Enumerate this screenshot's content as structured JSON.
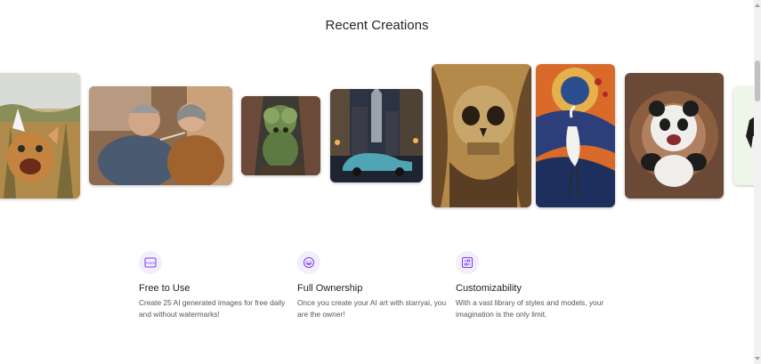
{
  "section": {
    "title": "Recent Creations"
  },
  "gallery": {
    "images": [
      "cat-in-cornfield-image",
      "elderly-couple-painting-image",
      "broccoli-creature-image",
      "vintage-car-city-image",
      "golden-skull-image",
      "crane-bird-art-image",
      "panda-portrait-image",
      "partial-next-image"
    ]
  },
  "features": [
    {
      "icon": "free-badge-icon",
      "title": "Free to Use",
      "text": "Create 25 AI generated images for free daily and without watermarks!"
    },
    {
      "icon": "smile-face-icon",
      "title": "Full Ownership",
      "text": "Once you create your AI art with starryai, you are the owner!"
    },
    {
      "icon": "sliders-icon",
      "title": "Customizability",
      "text": "With a vast library of styles and models, your imagination is the only limit."
    }
  ],
  "colors": {
    "accent": "#7c3aed",
    "icon_bg": "#f3eefc"
  }
}
